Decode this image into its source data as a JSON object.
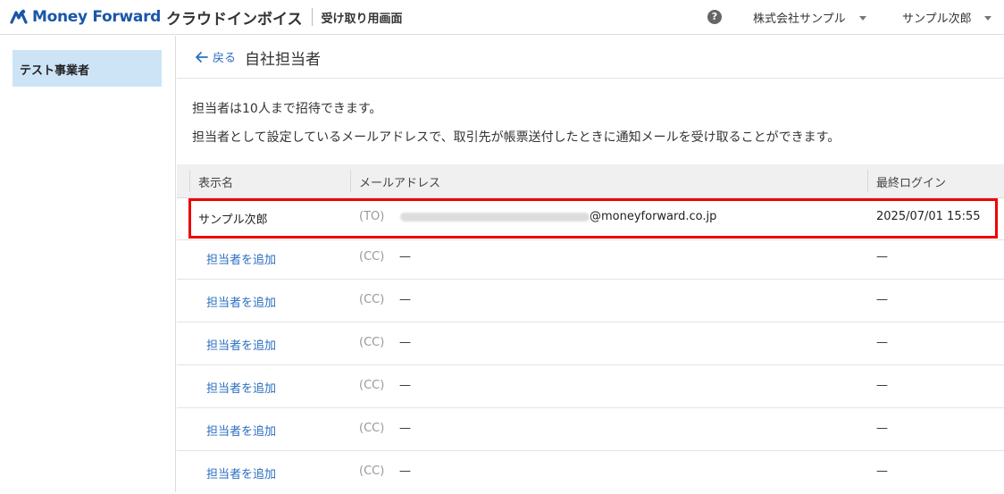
{
  "header": {
    "brand": "Money Forward",
    "product": "クラウドインボイス",
    "mode": "受け取り用画面",
    "help": "?",
    "company": "株式会社サンプル",
    "user": "サンプル次郎",
    "brand_color": "#1a56a8"
  },
  "sidebar": {
    "items": [
      {
        "label": "テスト事業者",
        "active": true
      }
    ]
  },
  "page": {
    "back_label": "戻る",
    "title": "自社担当者",
    "desc1": "担当者は10人まで招待できます。",
    "desc2": "担当者として設定しているメールアドレスで、取引先が帳票送付したときに通知メールを受け取ることができます。"
  },
  "table": {
    "headers": {
      "name": "表示名",
      "email": "メールアドレス",
      "last_login": "最終ログイン"
    },
    "rows": [
      {
        "name": "サンプル次郎",
        "type": "(TO)",
        "email_domain": "@moneyforward.co.jp",
        "last_login": "2025/07/01 15:55"
      },
      {
        "name": "担当者を追加",
        "type": "(CC)",
        "email": "—",
        "last_login": "—"
      },
      {
        "name": "担当者を追加",
        "type": "(CC)",
        "email": "—",
        "last_login": "—"
      },
      {
        "name": "担当者を追加",
        "type": "(CC)",
        "email": "—",
        "last_login": "—"
      },
      {
        "name": "担当者を追加",
        "type": "(CC)",
        "email": "—",
        "last_login": "—"
      },
      {
        "name": "担当者を追加",
        "type": "(CC)",
        "email": "—",
        "last_login": "—"
      },
      {
        "name": "担当者を追加",
        "type": "(CC)",
        "email": "—",
        "last_login": "—"
      }
    ]
  },
  "colors": {
    "highlight": "#e00000",
    "link": "#2a6fc0",
    "sidebar_active": "#cde4f7"
  }
}
